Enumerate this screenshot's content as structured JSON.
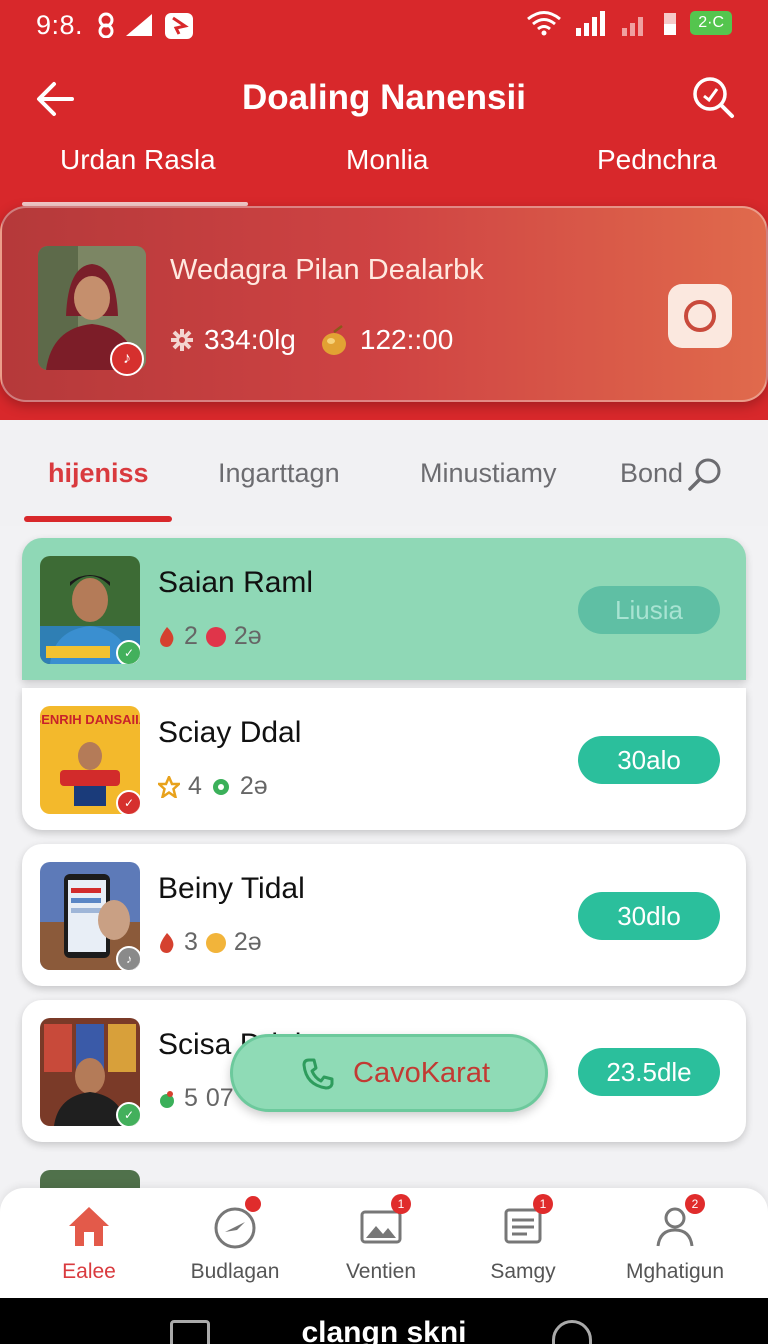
{
  "status_bar": {
    "time": "9:8.",
    "battery": "2·C"
  },
  "header": {
    "title": "Doaling Nanensii"
  },
  "top_tabs": [
    "Urdan Rasla",
    "Monlia",
    "Pednchra"
  ],
  "hero": {
    "name": "Wedagra Pilan Dealarbk",
    "stat1": "334:0lg",
    "stat2": "122::00"
  },
  "sub_tabs": [
    "hijeniss",
    "Ingarttagn",
    "Minustiamy",
    "Bond"
  ],
  "list": [
    {
      "name": "Saian Raml",
      "count": "2",
      "extra": "2ə",
      "action": "Liusia",
      "thumb_text": ""
    },
    {
      "name": "Sciay Ddal",
      "count": "4",
      "extra": "2ə",
      "action": "30alo",
      "thumb_text": "BENRIH DANSAIIA"
    },
    {
      "name": "Beiny Tidal",
      "count": "3",
      "extra": "2ə",
      "action": "30dlo",
      "thumb_text": ""
    },
    {
      "name": "Scisa Ddal",
      "count": "5",
      "extra": "07",
      "action": "23.5dle",
      "thumb_text": ""
    }
  ],
  "call_button": {
    "label": "CavoKarat"
  },
  "bottom_nav": [
    {
      "label": "Ealee",
      "icon": "home-icon",
      "badge": ""
    },
    {
      "label": "Budlagan",
      "icon": "compass-icon",
      "badge": ""
    },
    {
      "label": "Ventien",
      "icon": "image-icon",
      "badge": "1"
    },
    {
      "label": "Samgy",
      "icon": "document-icon",
      "badge": "1"
    },
    {
      "label": "Mghatigun",
      "icon": "profile-icon",
      "badge": "2"
    }
  ],
  "system_bar": {
    "label": "clangn skni"
  },
  "colors": {
    "primary": "#d8282b",
    "highlight_row": "#8fd8b6",
    "pill": "#2bbf9c"
  }
}
